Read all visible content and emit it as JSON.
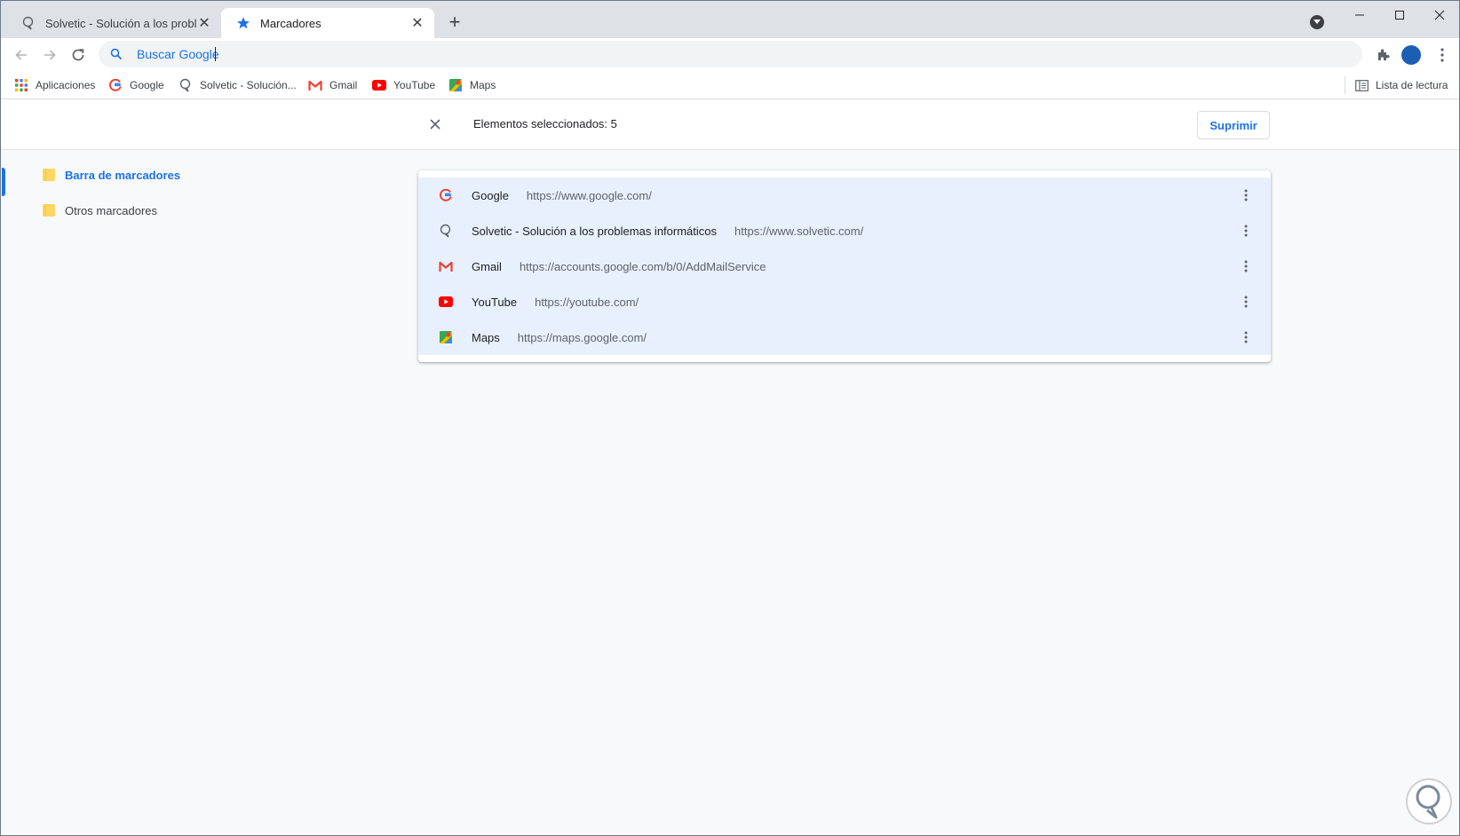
{
  "browser": {
    "tabs": [
      {
        "title": "Solvetic - Solución a los problemas informáticos",
        "active": false
      },
      {
        "title": "Marcadores",
        "active": true
      }
    ],
    "omnibox": {
      "placeholder": "Buscar Google"
    }
  },
  "bookmarks_bar": {
    "apps_label": "Aplicaciones",
    "items": [
      {
        "label": "Google",
        "icon": "google-icon"
      },
      {
        "label": "Solvetic - Solución...",
        "icon": "solvetic-icon"
      },
      {
        "label": "Gmail",
        "icon": "gmail-icon"
      },
      {
        "label": "YouTube",
        "icon": "youtube-icon"
      },
      {
        "label": "Maps",
        "icon": "maps-icon"
      }
    ],
    "reading_list_label": "Lista de lectura"
  },
  "selection": {
    "count_label": "Elementos seleccionados: 5",
    "delete_label": "Suprimir"
  },
  "sidebar": {
    "folders": [
      {
        "label": "Barra de marcadores",
        "selected": true
      },
      {
        "label": "Otros marcadores",
        "selected": false
      }
    ]
  },
  "bookmarks": [
    {
      "title": "Google",
      "url": "https://www.google.com/",
      "icon": "google-icon"
    },
    {
      "title": "Solvetic - Solución a los problemas informáticos",
      "url": "https://www.solvetic.com/",
      "icon": "solvetic-icon"
    },
    {
      "title": "Gmail",
      "url": "https://accounts.google.com/b/0/AddMailService",
      "icon": "gmail-icon"
    },
    {
      "title": "YouTube",
      "url": "https://youtube.com/",
      "icon": "youtube-icon"
    },
    {
      "title": "Maps",
      "url": "https://maps.google.com/",
      "icon": "maps-icon"
    }
  ],
  "colors": {
    "accent": "#1a73e8",
    "selected_row": "#e8f0fe",
    "folder": "#fdd663"
  }
}
